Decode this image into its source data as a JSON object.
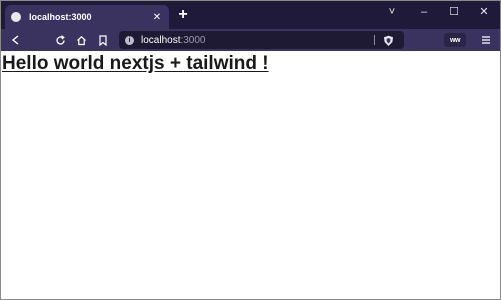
{
  "browser": {
    "tab": {
      "title": "localhost:3000",
      "close_icon": "close-icon"
    },
    "new_tab_label": "+",
    "window_controls": {
      "menu": "˅",
      "minimize": "–",
      "maximize": "☐",
      "close": "✕"
    },
    "toolbar": {
      "icons": [
        "back-icon",
        "reload-icon",
        "home-icon",
        "bookmark-icon",
        "info-icon",
        "shield-icon",
        "extension-icon",
        "menu-icon"
      ],
      "extension_label": "ww"
    },
    "url": {
      "host": "localhost",
      "port": ":3000"
    }
  },
  "page": {
    "heading": "Hello world nextjs + tailwind !"
  },
  "colors": {
    "titlebar": "#201a3a",
    "toolbar": "#3a3360",
    "urlbar": "#1f1a33",
    "page_background": "#ffffff",
    "heading_text": "#1a1a1a"
  }
}
